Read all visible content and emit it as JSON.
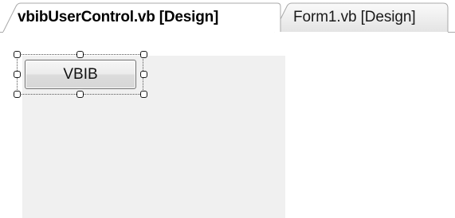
{
  "tabs": [
    {
      "label": "vbibUserControl.vb [Design]",
      "active": true
    },
    {
      "label": "Form1.vb [Design]",
      "active": false
    }
  ],
  "designer": {
    "control": {
      "type": "button",
      "text": "VBIB",
      "selected": true
    }
  },
  "colors": {
    "surface": "#f0f0f0",
    "tab_border": "#a0a0a0",
    "handle_border": "#1a1a1a"
  }
}
